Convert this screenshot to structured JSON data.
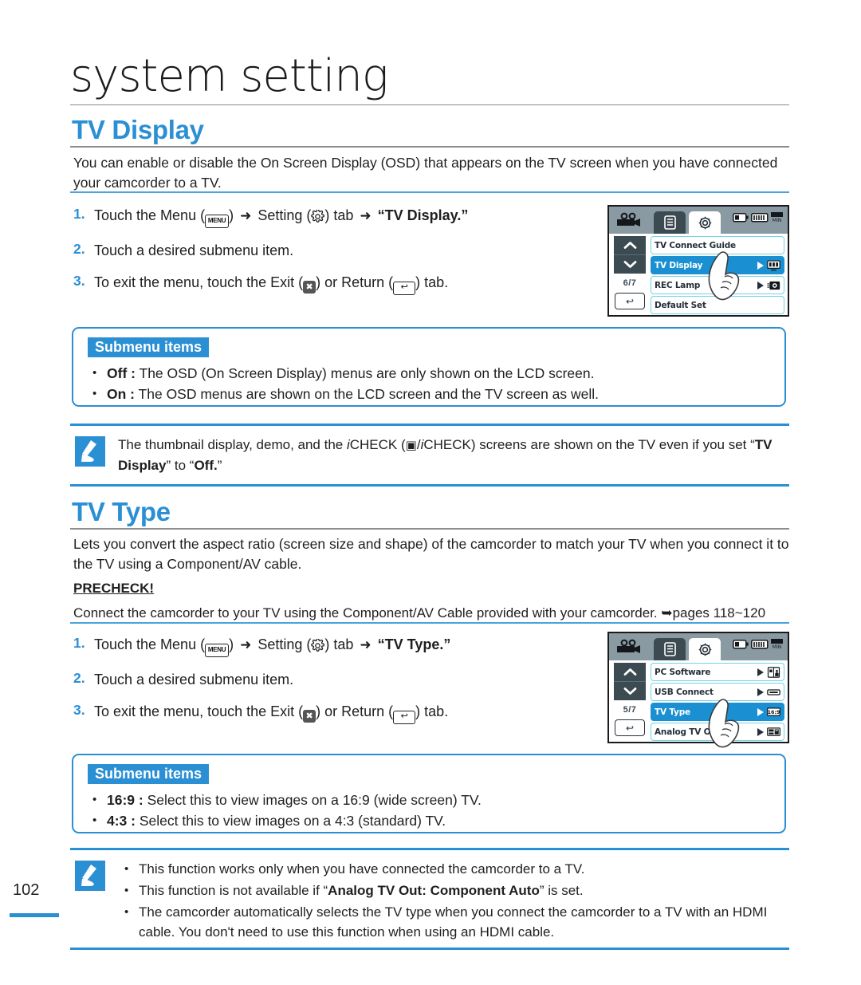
{
  "header": {
    "chapter_title": "system setting"
  },
  "sections": [
    {
      "id": "tv-display",
      "heading": "TV Display",
      "intro": "You can enable or disable the On Screen Display (OSD) that appears on the TV screen when you have connected your camcorder to a TV.",
      "steps": [
        {
          "num": "1.",
          "pre": "Touch the Menu (",
          "icon1": "MENU",
          "mid1": ") ",
          "arrow1": "➜",
          "mid2": " Setting (",
          "icon2": "gear-icon",
          "mid3": ") tab ",
          "arrow2": "➜",
          "bold": " “TV Display.”"
        },
        {
          "num": "2.",
          "text": "Touch a desired submenu item."
        },
        {
          "num": "3.",
          "pre": "To exit the menu, touch the Exit (",
          "icon1": "✖",
          "mid1": ") or Return (",
          "icon2": "↩",
          "post": ") tab."
        }
      ],
      "submenu": {
        "badge": "Submenu items",
        "items": [
          {
            "term": "Off :",
            "desc": " The OSD (On Screen Display) menus are only shown on the LCD screen."
          },
          {
            "term": "On :",
            "desc": " The OSD menus are shown on the LCD screen and the TV screen as well."
          }
        ]
      }
    },
    {
      "id": "tv-type",
      "heading": "TV Type",
      "intro": "Lets you convert the aspect ratio (screen size and shape) of the camcorder to match your TV when you connect it to the TV using a Component/AV cable.",
      "precheck_label": "PRECHECK!",
      "precheck_text": "Connect the camcorder to your TV using the Component/AV Cable provided with your camcorder. ➥pages 118~120",
      "steps": [
        {
          "num": "1.",
          "pre": "Touch the Menu (",
          "icon1": "MENU",
          "mid1": ") ",
          "arrow1": "➜",
          "mid2": " Setting (",
          "icon2": "gear-icon",
          "mid3": ") tab ",
          "arrow2": "➜",
          "bold": " “TV Type.”"
        },
        {
          "num": "2.",
          "text": "Touch a desired submenu item."
        },
        {
          "num": "3.",
          "pre": "To exit the menu, touch the Exit (",
          "icon1": "✖",
          "mid1": ") or Return (",
          "icon2": "↩",
          "post": ") tab."
        }
      ],
      "submenu": {
        "badge": "Submenu items",
        "items": [
          {
            "term": "16:9 :",
            "desc": " Select this to view images on a 16:9 (wide screen) TV."
          },
          {
            "term": "4:3 :",
            "desc": " Select this to view images on a 4:3 (standard) TV."
          }
        ]
      }
    }
  ],
  "notes": {
    "note1": {
      "part1": "The thumbnail display, demo, and the ",
      "italic1": "i",
      "part2": "CHECK (",
      "icon": "▣",
      "part3": "/",
      "italic2": "i",
      "part4": "CHECK) screens are shown on the TV even if you set “",
      "bold1": "TV Display",
      "part5": "” to “",
      "bold2": "Off.",
      "part6": "”"
    },
    "note2": {
      "items": [
        {
          "text": "This function works only when you have connected the camcorder to a TV."
        },
        {
          "pre": "This function is not available if “",
          "bold": "Analog TV Out: Component Auto",
          "post": "” is set."
        },
        {
          "text": "The camcorder automatically selects the TV type when you connect the camcorder to a TV with an HDMI cable. You don't need to use this function when using an HDMI cable."
        }
      ]
    }
  },
  "lcd_screens": [
    {
      "id": "lcd-tv-display",
      "page_indicator": "6/7",
      "tabs": [
        "camcorder-icon",
        "list-tab-icon",
        "gear-tab-icon"
      ],
      "status_icons": [
        "battery-icon",
        "memory-icon",
        "min-icon"
      ],
      "rows": [
        {
          "label": "TV Connect Guide",
          "selected": false,
          "has_arrow": false,
          "icon": ""
        },
        {
          "label": "TV Display",
          "selected": true,
          "has_arrow": true,
          "icon": "tv-display-icon"
        },
        {
          "label": "REC Lamp",
          "selected": false,
          "has_arrow": true,
          "icon": "rec-lamp-icon"
        },
        {
          "label": "Default Set",
          "selected": false,
          "has_arrow": false,
          "icon": ""
        }
      ],
      "return_btn": "↩",
      "up_btn": "▲",
      "down_btn": "▼"
    },
    {
      "id": "lcd-tv-type",
      "page_indicator": "5/7",
      "tabs": [
        "camcorder-icon",
        "list-tab-icon",
        "gear-tab-icon"
      ],
      "status_icons": [
        "battery-icon",
        "memory-icon",
        "min-icon"
      ],
      "rows": [
        {
          "label": "PC Software",
          "selected": false,
          "has_arrow": true,
          "icon": "pc-software-icon"
        },
        {
          "label": "USB Connect",
          "selected": false,
          "has_arrow": true,
          "icon": "usb-connect-icon"
        },
        {
          "label": "TV Type",
          "selected": true,
          "has_arrow": true,
          "icon": "tv-type-icon"
        },
        {
          "label": "Analog TV Out",
          "selected": false,
          "has_arrow": true,
          "icon": "analog-tv-out-icon"
        }
      ],
      "return_btn": "↩",
      "up_btn": "▲",
      "down_btn": "▼"
    }
  ],
  "footer": {
    "page_number": "102"
  },
  "colors": {
    "accent_blue": "#2b8fd4",
    "lcd_select_blue": "#1a8fd1",
    "lcd_header_gray": "#8a9aa2",
    "lcd_tab_dark": "#3c4a52"
  }
}
